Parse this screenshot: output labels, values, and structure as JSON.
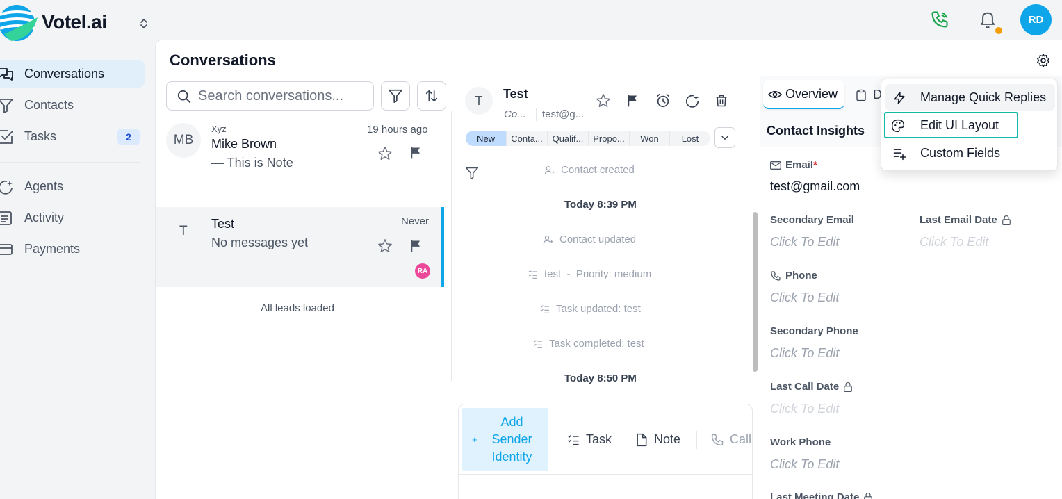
{
  "app": {
    "brand": "Votel.ai",
    "user_initials": "RD"
  },
  "sidebar": {
    "items": [
      {
        "label": "Conversations"
      },
      {
        "label": "Contacts"
      },
      {
        "label": "Tasks",
        "badge": "2"
      },
      {
        "label": "Agents"
      },
      {
        "label": "Activity"
      },
      {
        "label": "Payments"
      }
    ]
  },
  "page": {
    "title": "Conversations"
  },
  "search": {
    "placeholder": "Search conversations..."
  },
  "conversations": [
    {
      "initials": "MB",
      "label": "Xyz",
      "name": "Mike Brown",
      "preview": "—  This is Note",
      "time": "19 hours ago"
    },
    {
      "initials": "T",
      "name": "Test",
      "preview": "No messages yet",
      "time": "Never",
      "assignee": "RA"
    }
  ],
  "list_footer": "All leads loaded",
  "contact": {
    "initial": "T",
    "name": "Test",
    "sub_left": "Co...",
    "sub_right": "test@g...",
    "stages": [
      "New",
      "Conta...",
      "Qualif...",
      "Propo...",
      "Won",
      "Lost"
    ]
  },
  "timeline": [
    {
      "type": "event",
      "icon": "user-plus-icon",
      "text": "Contact created"
    },
    {
      "type": "time",
      "text": "Today 8:39 PM"
    },
    {
      "type": "event",
      "icon": "user-plus-icon",
      "text": "Contact updated"
    },
    {
      "type": "event",
      "icon": "task-list-icon",
      "text": "test  -  Priority: medium"
    },
    {
      "type": "event",
      "icon": "task-list-icon",
      "text": "Task updated: test"
    },
    {
      "type": "event",
      "icon": "task-list-icon",
      "text": "Task completed: test"
    },
    {
      "type": "time",
      "text": "Today 8:50 PM"
    }
  ],
  "composer": {
    "add_sender_line1": "Add",
    "add_sender_line2": "Sender",
    "add_sender_line3": "Identity",
    "task": "Task",
    "note": "Note",
    "call": "Call"
  },
  "details": {
    "tab_overview": "Overview",
    "tab_second": "D",
    "section_title": "Contact Insights",
    "email_label": "Email",
    "required_mark": "*",
    "email_value": "test@gmail.com",
    "fields": {
      "secondary_email": {
        "label": "Secondary Email",
        "value": "Click To Edit"
      },
      "last_email_date": {
        "label": "Last Email Date",
        "value": "Click To Edit"
      },
      "phone": {
        "label": "Phone",
        "value": "Click To Edit"
      },
      "secondary_phone": {
        "label": "Secondary Phone",
        "value": "Click To Edit"
      },
      "last_call_date": {
        "label": "Last Call Date",
        "value": "Click To Edit"
      },
      "work_phone": {
        "label": "Work Phone",
        "value": "Click To Edit"
      },
      "last_meeting_date": {
        "label": "Last Meeting Date"
      }
    }
  },
  "settings_menu": {
    "items": [
      {
        "label": "Manage Quick Replies"
      },
      {
        "label": "Edit UI Layout"
      },
      {
        "label": "Custom Fields"
      }
    ]
  },
  "colors": {
    "accent": "#0ea5e9",
    "highlight": "#14b8a6",
    "active_nav": "#e0effa",
    "phone_icon": "#16a34a",
    "notification_dot": "#f59e0b",
    "assignee": "#ec4899"
  }
}
